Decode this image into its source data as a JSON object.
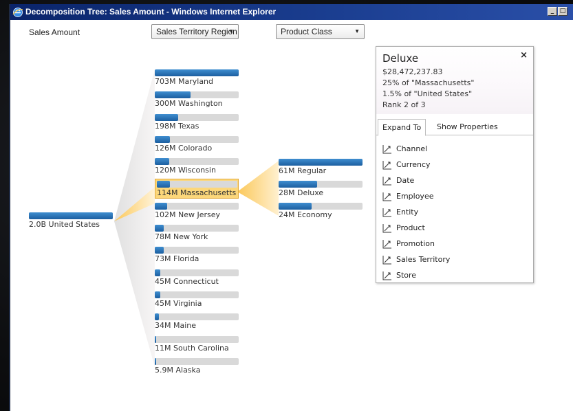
{
  "window": {
    "title": "Decomposition Tree: Sales Amount - Windows Internet Explorer",
    "buttons": {
      "minimize": "_",
      "maximize": "□"
    },
    "colors": {
      "titlebar": "#0a246a",
      "bar_fill": "#1c5fa0",
      "bar_track": "#d9d9d9",
      "selected": "#fcd77a"
    }
  },
  "header": {
    "measure_label": "Sales Amount",
    "level2_dropdown": "Sales Territory Region",
    "level3_dropdown": "Product Class"
  },
  "tree": {
    "root": {
      "value": "2.0B",
      "name": "United States",
      "fill": 1.0
    },
    "regions": [
      {
        "value": "703M",
        "name": "Maryland",
        "fill": 1.0
      },
      {
        "value": "300M",
        "name": "Washington",
        "fill": 0.43
      },
      {
        "value": "198M",
        "name": "Texas",
        "fill": 0.28
      },
      {
        "value": "126M",
        "name": "Colorado",
        "fill": 0.18
      },
      {
        "value": "120M",
        "name": "Wisconsin",
        "fill": 0.17
      },
      {
        "value": "114M",
        "name": "Massachusetts",
        "fill": 0.16,
        "selected": true
      },
      {
        "value": "102M",
        "name": "New Jersey",
        "fill": 0.145
      },
      {
        "value": "78M",
        "name": "New York",
        "fill": 0.11
      },
      {
        "value": "73M",
        "name": "Florida",
        "fill": 0.104
      },
      {
        "value": "45M",
        "name": "Connecticut",
        "fill": 0.064
      },
      {
        "value": "45M",
        "name": "Virginia",
        "fill": 0.064
      },
      {
        "value": "34M",
        "name": "Maine",
        "fill": 0.048
      },
      {
        "value": "11M",
        "name": "South Carolina",
        "fill": 0.016
      },
      {
        "value": "5.9M",
        "name": "Alaska",
        "fill": 0.008
      }
    ],
    "product_classes": [
      {
        "value": "61M",
        "name": "Regular",
        "fill": 1.0
      },
      {
        "value": "28M",
        "name": "Deluxe",
        "fill": 0.46
      },
      {
        "value": "24M",
        "name": "Economy",
        "fill": 0.39
      }
    ]
  },
  "popup": {
    "title": "Deluxe",
    "amount": "$28,472,237.83",
    "pct_parent": "25% of \"Massachusetts\"",
    "pct_root": "1.5% of \"United States\"",
    "rank": "Rank 2 of 3",
    "close": "×",
    "tabs": [
      "Expand To",
      "Show Properties"
    ],
    "expand_items": [
      "Channel",
      "Currency",
      "Date",
      "Employee",
      "Entity",
      "Product",
      "Promotion",
      "Sales Territory",
      "Store"
    ]
  }
}
